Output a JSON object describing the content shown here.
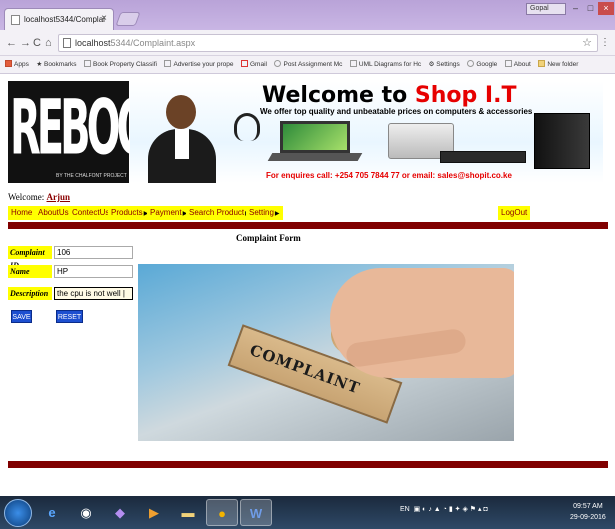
{
  "browser": {
    "tab_title": "localhost5344/Complai",
    "tab_close": "×",
    "profile_label": "Gopal",
    "back": "←",
    "forward": "→",
    "reload": "C",
    "home": "⌂",
    "url_host": "localhost",
    "url_rest": "5344/Complaint.aspx",
    "star": "☆",
    "menu": "⋮"
  },
  "bookmarks": [
    {
      "label": "Apps",
      "icon": "apps-icon"
    },
    {
      "label": "Bookmarks",
      "icon": "star-icon"
    },
    {
      "label": "Book Property Classifi",
      "icon": "page-icon"
    },
    {
      "label": "Advertise your prope",
      "icon": "page-icon"
    },
    {
      "label": "Gmail",
      "icon": "gmail-icon"
    },
    {
      "label": "Post Assignment Mc",
      "icon": "google-icon"
    },
    {
      "label": "UML Diagrams for Hc",
      "icon": "page-icon"
    },
    {
      "label": "Settings",
      "icon": "gear-icon"
    },
    {
      "label": "Google",
      "icon": "google-icon"
    },
    {
      "label": "About",
      "icon": "page-icon"
    },
    {
      "label": "New folder",
      "icon": "folder-icon"
    }
  ],
  "header": {
    "logo_text": "REBOOT!",
    "logo_sub": "BY THE CHALFONT PROJECT",
    "welcome_prefix": "Welcome to ",
    "brand": "Shop I.T",
    "tagline": "We offer top quality and unbeatable prices on computers & accessories",
    "contact": "For enquires call: +254 705 7844 77 or email: sales@shopit.co.ke"
  },
  "user": {
    "welcome_label": "Welcome: ",
    "name": "Arjun"
  },
  "menu": {
    "items": [
      {
        "label": "Home"
      },
      {
        "label": "AboutUs"
      },
      {
        "label": "ContectUs"
      },
      {
        "label": "Products",
        "arrow": "▶"
      },
      {
        "label": "Payment",
        "arrow": "▶"
      },
      {
        "label": "Search Product",
        "arrow": "▶"
      },
      {
        "label": "Setting",
        "arrow": "▶"
      }
    ],
    "logout": "LogOut"
  },
  "form": {
    "title": "Complaint Form",
    "complaint_id_label": "Complaint ID",
    "complaint_id_value": "106",
    "name_label": "Name",
    "name_value": "HP",
    "description_label": "Description",
    "description_value": "the cpu is not well |",
    "save_button": "SAVE",
    "reset_button": "RESET",
    "image_text": "COMPLAINT"
  },
  "taskbar": {
    "icons": [
      "start-orb",
      "ie-icon",
      "media-icon",
      "visual-studio-icon",
      "player-icon",
      "explorer-icon",
      "chrome-icon",
      "word-icon"
    ],
    "lang": "EN",
    "time": "09:57 AM",
    "date": "29-09-2016"
  }
}
